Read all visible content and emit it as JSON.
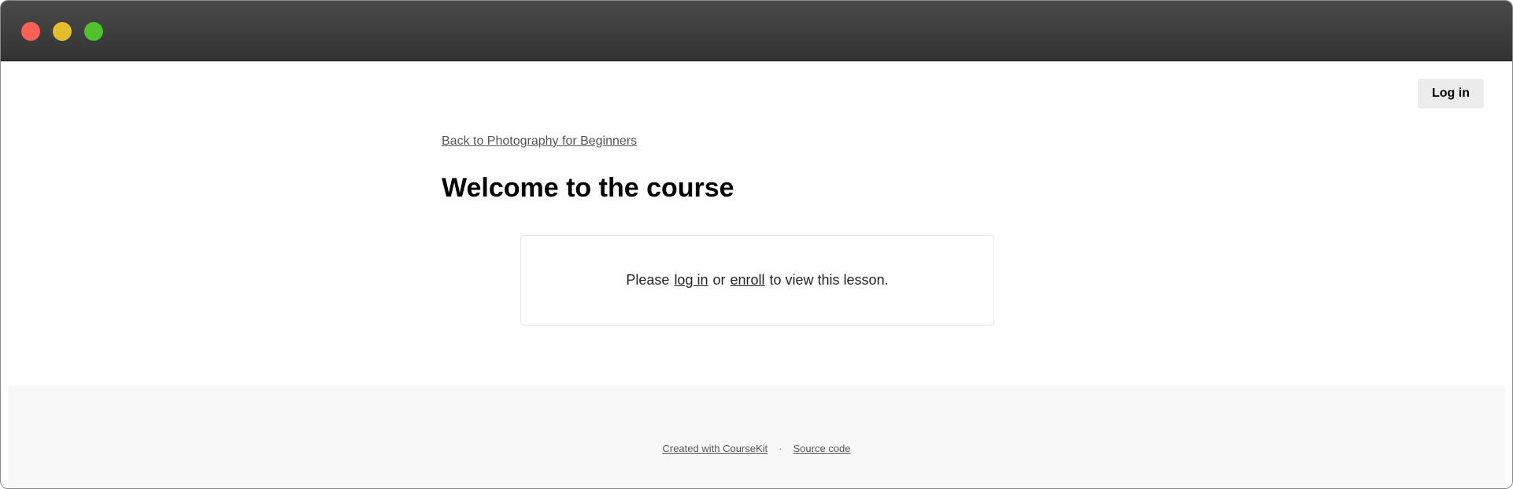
{
  "window": {
    "controls": [
      "close",
      "minimize",
      "maximize"
    ]
  },
  "header": {
    "login_label": "Log in"
  },
  "main": {
    "back_link": "Back to Photography for Beginners",
    "title": "Welcome to the course",
    "notice": {
      "prefix": "Please",
      "login_link": "log in",
      "middle": "or",
      "enroll_link": "enroll",
      "suffix": "to view this lesson."
    }
  },
  "footer": {
    "created_with": "Created with CourseKit",
    "separator": "·",
    "source_code": "Source code"
  }
}
